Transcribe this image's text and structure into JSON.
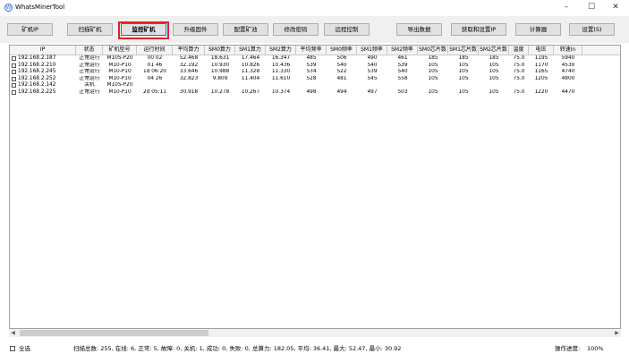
{
  "window": {
    "title": "WhatsMinerTool",
    "minimize": "–",
    "maximize": "☐",
    "close": "✕"
  },
  "toolbar": {
    "buttons": [
      "矿机IP",
      "扫描矿机",
      "监控矿机",
      "升级固件",
      "配置矿池",
      "修改密码",
      "远程控制",
      "导出数据",
      "获取和设置IP",
      "计算器",
      "设置(S)"
    ],
    "active_index": 2
  },
  "table": {
    "columns": [
      "IP",
      "状态",
      "矿机型号",
      "运行时间",
      "平均算力",
      "SM0算力",
      "SM1算力",
      "SM2算力",
      "平均频率",
      "SM0频率",
      "SM1频率",
      "SM2频率",
      "SM0芯片数",
      "SM1芯片数",
      "SM2芯片数",
      "温度",
      "电压",
      "转速In"
    ],
    "rows": [
      [
        "192.168.2.187",
        "正常运行",
        "M10S-P20",
        "00 02",
        "52.468",
        "18.631",
        "17.464",
        "16.347",
        "485",
        "506",
        "490",
        "461",
        "185",
        "185",
        "185",
        "75.0",
        "1195",
        "5940"
      ],
      [
        "192.168.2.210",
        "正常运行",
        "M10-P10",
        "01 46",
        "32.192",
        "10.930",
        "10.826",
        "10.436",
        "539",
        "540",
        "540",
        "539",
        "105",
        "105",
        "105",
        "75.0",
        "1170",
        "4530"
      ],
      [
        "192.168.2.245",
        "正常运行",
        "M10-P10",
        "1d 06:20",
        "33.646",
        "10.988",
        "11.328",
        "11.330",
        "534",
        "522",
        "539",
        "540",
        "105",
        "105",
        "105",
        "75.0",
        "1165",
        "4740"
      ],
      [
        "192.168.2.252",
        "正常运行",
        "M10-P10",
        "04 26",
        "32.823",
        "9.809",
        "11.404",
        "11.610",
        "528",
        "481",
        "545",
        "558",
        "105",
        "105",
        "105",
        "75.0",
        "1205",
        "4800"
      ],
      [
        "192.168.2.142",
        "关机",
        "M10S-P20",
        "",
        "",
        "",
        "",
        "",
        "",
        "",
        "",
        "",
        "",
        "",
        "",
        "",
        "",
        ""
      ],
      [
        "192.168.2.225",
        "正常运行",
        "M10-P10",
        "2d 05:11",
        "30.918",
        "10.278",
        "10.267",
        "10.374",
        "498",
        "494",
        "497",
        "503",
        "105",
        "105",
        "105",
        "75.0",
        "1220",
        "4470"
      ]
    ]
  },
  "status": {
    "select_all_label": "全选",
    "summary": "扫描总数: 255, 在线: 6, 正常: 5, 故障: 0, 关机: 1, 成功: 0, 失败: 0, 总算力: 182.05, 平均: 36.41, 最大: 52.47, 最小: 30.92",
    "progress_label": "操作进度:",
    "progress_value": "100%"
  }
}
